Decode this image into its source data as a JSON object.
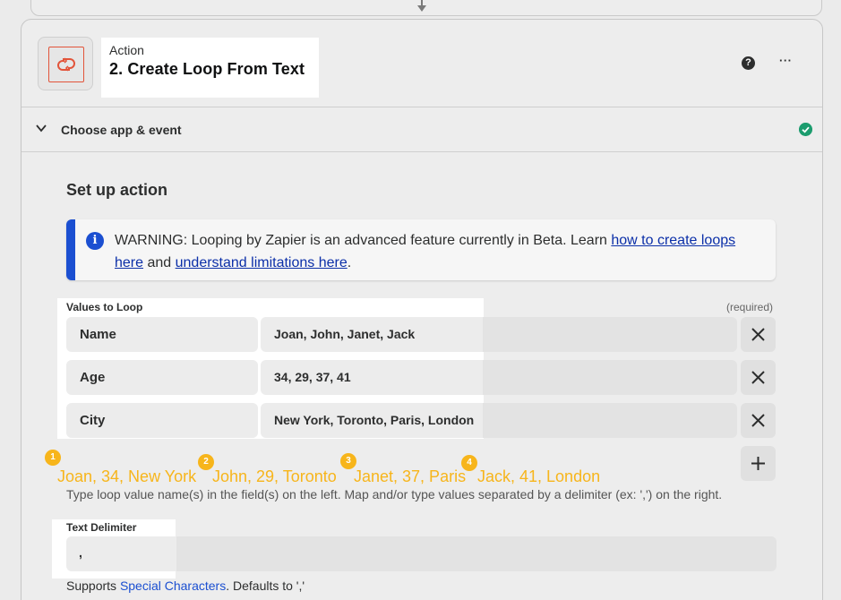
{
  "header": {
    "action_label": "Action",
    "step_title": "2. Create Loop From Text",
    "help_icon": "?",
    "more_icon": "···"
  },
  "choose_app": {
    "label": "Choose app & event",
    "status": "complete"
  },
  "setup": {
    "title": "Set up action",
    "warning": {
      "prefix": "WARNING: Looping by Zapier is an advanced feature currently in Beta. Learn ",
      "link1": "how to create loops here",
      "middle": " and ",
      "link2": "understand limitations here",
      "suffix": "."
    },
    "values_to_loop": {
      "label": "Values to Loop",
      "required": "(required)",
      "rows": [
        {
          "key": "Name",
          "value": "Joan, John, Janet, Jack"
        },
        {
          "key": "Age",
          "value": "34, 29, 37, 41"
        },
        {
          "key": "City",
          "value": "New York, Toronto, Paris, London"
        }
      ],
      "help_text": "Type loop value name(s) in the field(s) on the left. Map and/or type values separated by a delimiter (ex: ',') on the right."
    },
    "annotations": [
      {
        "number": "1",
        "text": "Joan, 34, New York"
      },
      {
        "number": "2",
        "text": "John, 29, Toronto"
      },
      {
        "number": "3",
        "text": "Janet, 37, Paris"
      },
      {
        "number": "4",
        "text": "Jack, 41, London"
      }
    ],
    "text_delimiter": {
      "label": "Text Delimiter",
      "value": ",",
      "supports_prefix": "Supports ",
      "supports_link": "Special Characters",
      "supports_suffix": ". Defaults to ','"
    }
  },
  "colors": {
    "accent_orange": "#f7b51b",
    "app_icon_red": "#e2543a",
    "info_blue": "#1b4fd1",
    "success_green": "#1c9c6e"
  }
}
